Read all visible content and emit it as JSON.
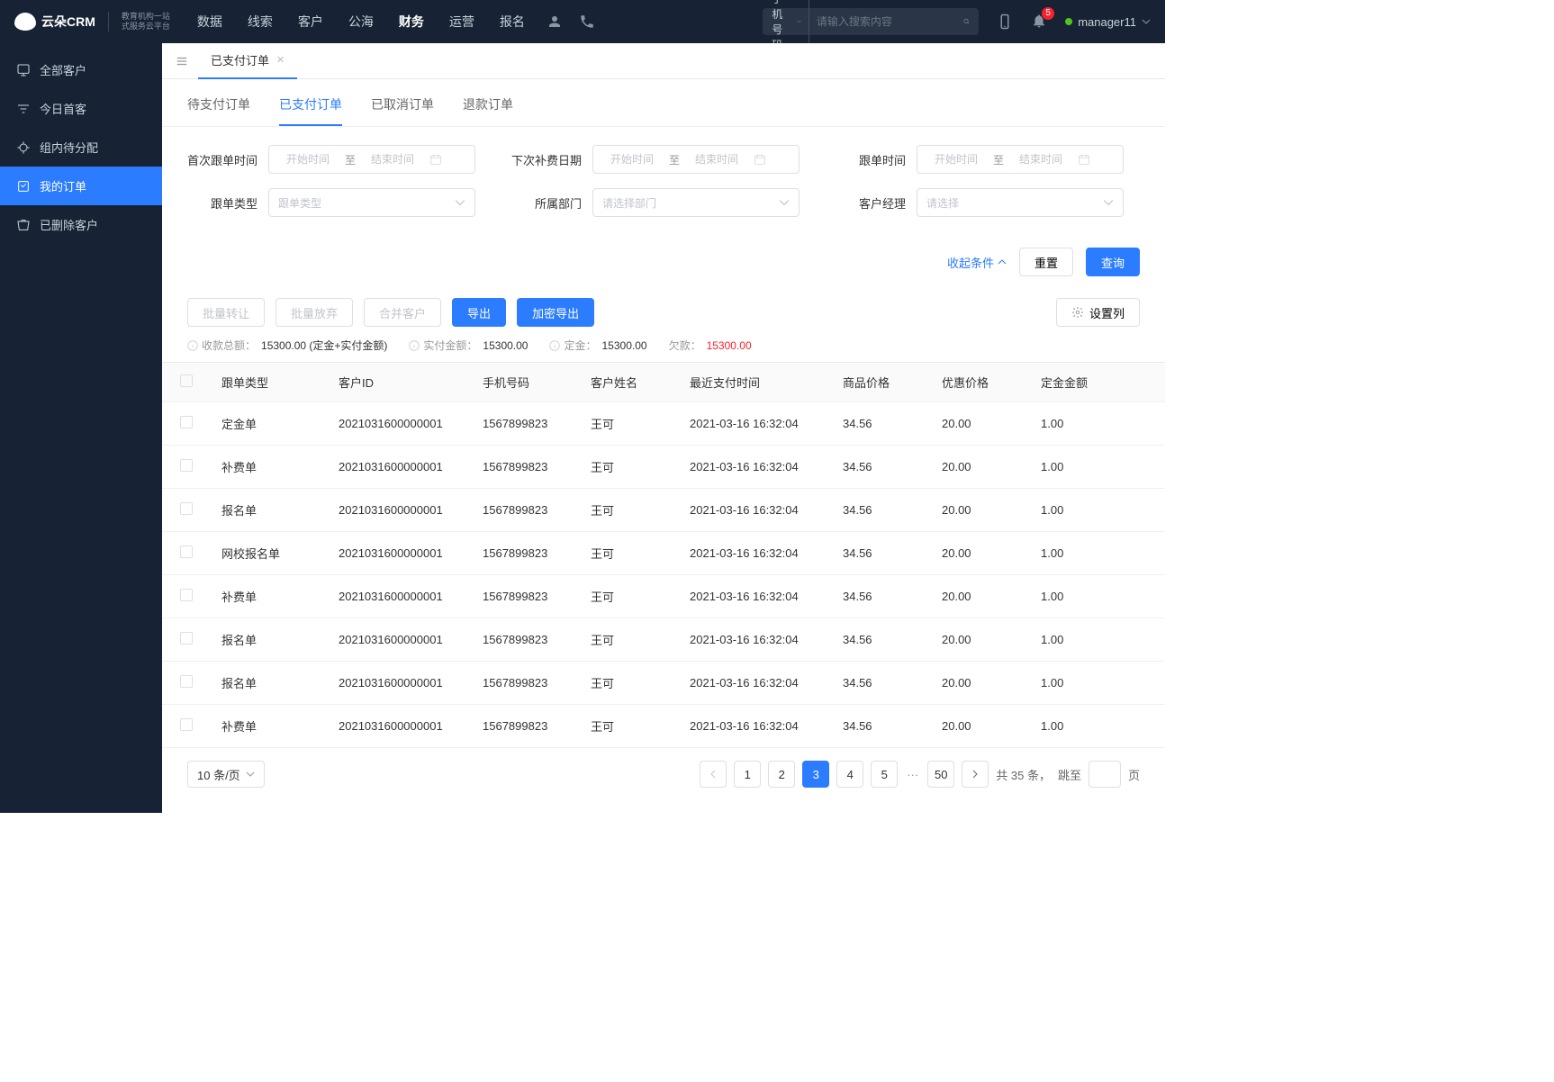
{
  "brand": {
    "name": "云朵CRM",
    "sub1": "教育机构一站",
    "sub2": "式服务云平台"
  },
  "topnav": [
    "数据",
    "线索",
    "客户",
    "公海",
    "财务",
    "运营",
    "报名"
  ],
  "topnav_active": 4,
  "search": {
    "type": "手机号码",
    "placeholder": "请输入搜索内容"
  },
  "notif_count": "5",
  "username": "manager11",
  "sidebar": [
    {
      "label": "全部客户"
    },
    {
      "label": "今日首客"
    },
    {
      "label": "组内待分配"
    },
    {
      "label": "我的订单",
      "active": true
    },
    {
      "label": "已删除客户"
    }
  ],
  "page_tab": "已支付订单",
  "sub_tabs": [
    "待支付订单",
    "已支付订单",
    "已取消订单",
    "退款订单"
  ],
  "sub_tab_active": 1,
  "filters": {
    "row1": [
      {
        "label": "首次跟单时间",
        "type": "daterange",
        "start": "开始时间",
        "sep": "至",
        "end": "结束时间"
      },
      {
        "label": "下次补费日期",
        "type": "daterange",
        "start": "开始时间",
        "sep": "至",
        "end": "结束时间"
      },
      {
        "label": "跟单时间",
        "type": "daterange",
        "start": "开始时间",
        "sep": "至",
        "end": "结束时间"
      }
    ],
    "row2": [
      {
        "label": "跟单类型",
        "type": "select",
        "placeholder": "跟单类型"
      },
      {
        "label": "所属部门",
        "type": "select",
        "placeholder": "请选择部门"
      },
      {
        "label": "客户经理",
        "type": "select",
        "placeholder": "请选择"
      }
    ]
  },
  "filter_actions": {
    "collapse": "收起条件",
    "reset": "重置",
    "query": "查询"
  },
  "toolbar": {
    "bulk_transfer": "批量转让",
    "bulk_abandon": "批量放弃",
    "merge": "合并客户",
    "export": "导出",
    "encrypt_export": "加密导出",
    "columns": "设置列"
  },
  "summary": {
    "total_label": "收款总额：",
    "total_val": "15300.00 (定金+实付金额)",
    "paid_label": "实付金额：",
    "paid_val": "15300.00",
    "deposit_label": "定金：",
    "deposit_val": "15300.00",
    "owed_label": "欠款：",
    "owed_val": "15300.00"
  },
  "columns": [
    "跟单类型",
    "客户ID",
    "手机号码",
    "客户姓名",
    "最近支付时间",
    "商品价格",
    "优惠价格",
    "定金金额"
  ],
  "rows": [
    {
      "type": "定金单",
      "id": "2021031600000001",
      "phone": "1567899823",
      "name": "王可",
      "time": "2021-03-16 16:32:04",
      "price": "34.56",
      "discount": "20.00",
      "deposit": "1.00"
    },
    {
      "type": "补费单",
      "id": "2021031600000001",
      "phone": "1567899823",
      "name": "王可",
      "time": "2021-03-16 16:32:04",
      "price": "34.56",
      "discount": "20.00",
      "deposit": "1.00"
    },
    {
      "type": "报名单",
      "id": "2021031600000001",
      "phone": "1567899823",
      "name": "王可",
      "time": "2021-03-16 16:32:04",
      "price": "34.56",
      "discount": "20.00",
      "deposit": "1.00"
    },
    {
      "type": "网校报名单",
      "id": "2021031600000001",
      "phone": "1567899823",
      "name": "王可",
      "time": "2021-03-16 16:32:04",
      "price": "34.56",
      "discount": "20.00",
      "deposit": "1.00"
    },
    {
      "type": "补费单",
      "id": "2021031600000001",
      "phone": "1567899823",
      "name": "王可",
      "time": "2021-03-16 16:32:04",
      "price": "34.56",
      "discount": "20.00",
      "deposit": "1.00"
    },
    {
      "type": "报名单",
      "id": "2021031600000001",
      "phone": "1567899823",
      "name": "王可",
      "time": "2021-03-16 16:32:04",
      "price": "34.56",
      "discount": "20.00",
      "deposit": "1.00"
    },
    {
      "type": "报名单",
      "id": "2021031600000001",
      "phone": "1567899823",
      "name": "王可",
      "time": "2021-03-16 16:32:04",
      "price": "34.56",
      "discount": "20.00",
      "deposit": "1.00"
    },
    {
      "type": "补费单",
      "id": "2021031600000001",
      "phone": "1567899823",
      "name": "王可",
      "time": "2021-03-16 16:32:04",
      "price": "34.56",
      "discount": "20.00",
      "deposit": "1.00"
    }
  ],
  "pager": {
    "page_size": "10 条/页",
    "pages": [
      "1",
      "2",
      "3",
      "4",
      "5"
    ],
    "active": 2,
    "last": "50",
    "total_prefix": "共",
    "total_count": "35",
    "total_suffix": "条，",
    "jump_label": "跳至",
    "jump_suffix": "页"
  }
}
